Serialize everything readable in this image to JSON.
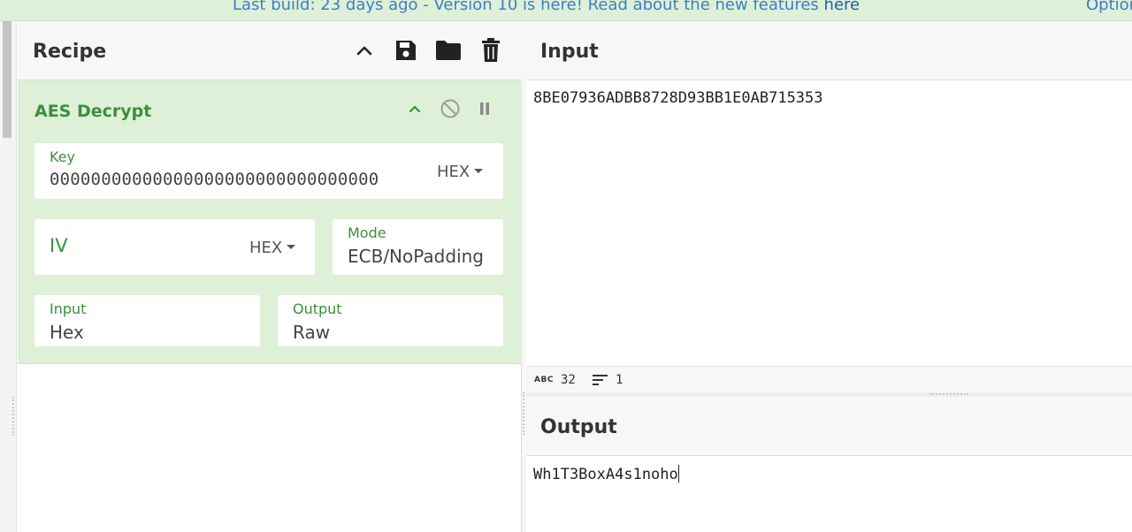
{
  "banner": {
    "text": "Last build: 23 days ago - Version 10 is here! Read about the new features ",
    "link": "here",
    "options": "Options"
  },
  "recipe": {
    "title": "Recipe",
    "icons": [
      "chevron-up-icon",
      "save-icon",
      "folder-icon",
      "trash-icon"
    ]
  },
  "operation": {
    "title": "AES Decrypt",
    "key": {
      "label": "Key",
      "value": "00000000000000000000000000000000",
      "format": "HEX"
    },
    "iv": {
      "label": "IV",
      "value": "",
      "format": "HEX"
    },
    "mode": {
      "label": "Mode",
      "value": "ECB/NoPadding"
    },
    "input": {
      "label": "Input",
      "value": "Hex"
    },
    "output": {
      "label": "Output",
      "value": "Raw"
    }
  },
  "input_pane": {
    "title": "Input",
    "content": "8BE07936ADBB8728D93BB1E0AB715353",
    "status": {
      "abc_label": "ABC",
      "length": "32",
      "lines": "1"
    }
  },
  "output_pane": {
    "title": "Output",
    "content": "Wh1T3BoxA4s1noho"
  },
  "colors": {
    "accent_green": "#3c8f3c",
    "op_background": "#dff0d8",
    "link_blue": "#3b7fc4"
  }
}
